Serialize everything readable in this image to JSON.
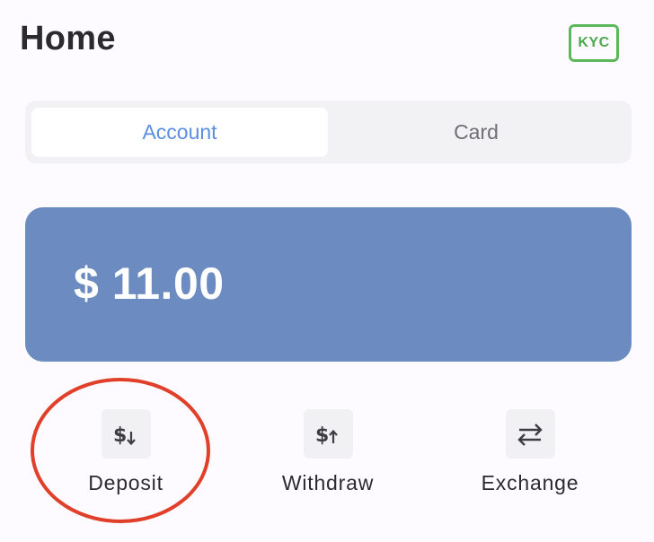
{
  "header": {
    "title": "Home",
    "kyc_label": "KYC",
    "kyc_color": "#5cb85c"
  },
  "tabs": [
    {
      "label": "Account",
      "active": true
    },
    {
      "label": "Card",
      "active": false
    }
  ],
  "balance": {
    "display": "$ 11.00",
    "card_color": "#6b8bc1"
  },
  "actions": [
    {
      "label": "Deposit",
      "icon": "dollar-down-icon"
    },
    {
      "label": "Withdraw",
      "icon": "dollar-up-icon"
    },
    {
      "label": "Exchange",
      "icon": "swap-arrows-icon"
    }
  ],
  "annotation": {
    "highlight": "red-circle-around-deposit",
    "color": "#e0402a"
  },
  "accent_color": "#5b8ee0"
}
